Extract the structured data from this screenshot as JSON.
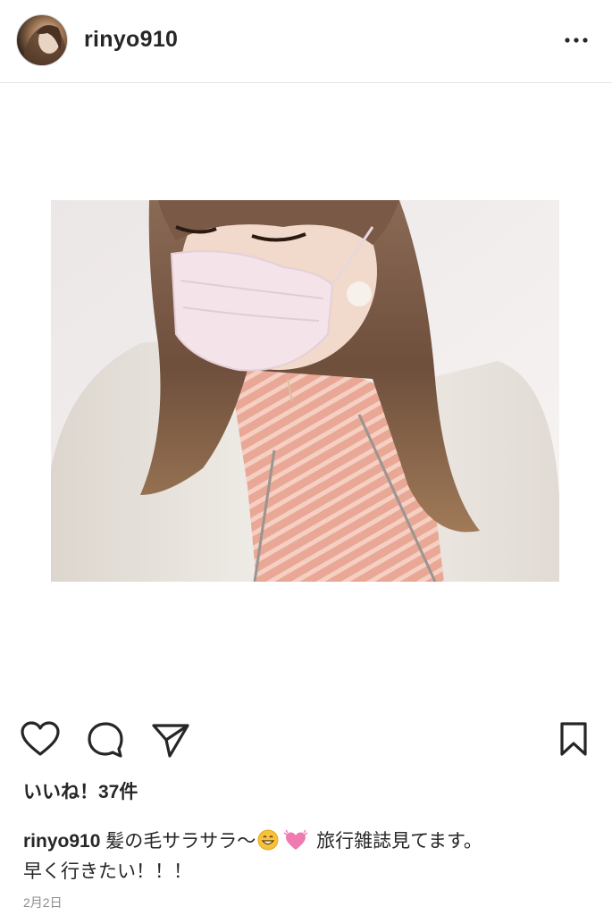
{
  "header": {
    "username": "rinyo910",
    "avatar_icon": "profile-avatar",
    "more_icon": "more-options-icon"
  },
  "post": {
    "image_icon": "post-photo"
  },
  "actions": {
    "like_icon": "heart-icon",
    "comment_icon": "comment-bubble-icon",
    "share_icon": "paper-plane-icon",
    "save_icon": "bookmark-icon"
  },
  "likes": {
    "text": "いいね！37件"
  },
  "caption": {
    "username": "rinyo910",
    "text_before_emoji": " 髪の毛サラサラ〜",
    "emoji_1": "grinning-face-emoji",
    "emoji_2": "growing-heart-emoji",
    "text_after_emoji": " 旅行雑誌見てます。",
    "line_2": "早く行きたい！！！"
  },
  "timestamp": {
    "text": "2月2日"
  },
  "colors": {
    "text": "#262626",
    "secondary": "#8e8e8e",
    "divider": "#e6e6e6"
  }
}
